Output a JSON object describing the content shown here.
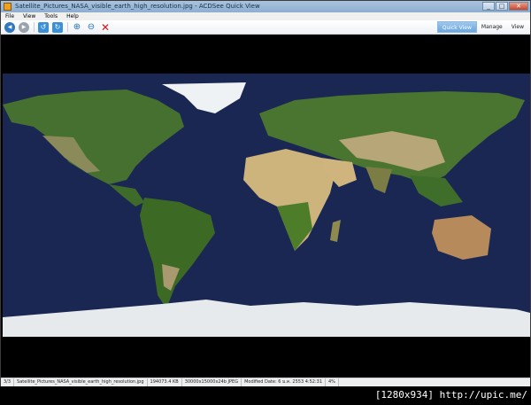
{
  "window": {
    "title": "Satellite_Pictures_NASA_visible_earth_high_resolution.jpg - ACDSee Quick View",
    "buttons": {
      "minimize": "_",
      "maximize": "□",
      "close": "✕"
    }
  },
  "menu": [
    "File",
    "View",
    "Tools",
    "Help"
  ],
  "toolbar": {
    "icons": [
      "previous-icon",
      "next-icon",
      "rotate-left-icon",
      "rotate-right-icon",
      "zoom-in-icon",
      "zoom-out-icon",
      "close-icon"
    ],
    "modes": [
      "Quick View",
      "Manage",
      "View"
    ],
    "active_mode": "Quick View"
  },
  "status": {
    "index": "3/3",
    "filename": "Satellite_Pictures_NASA_visible_earth_high_resolution.jpg",
    "size": "194073.4 KB",
    "dimensions": "30000x15000x24b JPEG",
    "modified": "Modified Date: 6 ม.ค. 2553 4:52:31",
    "zoom": "4%"
  },
  "watermark": "[1280x934] http://upic.me/",
  "colors": {
    "ocean": "#1a2753",
    "land": "#3f6b2a",
    "desert": "#c8ad78",
    "ice": "#e8ecef",
    "accent": "#6aa6de"
  }
}
